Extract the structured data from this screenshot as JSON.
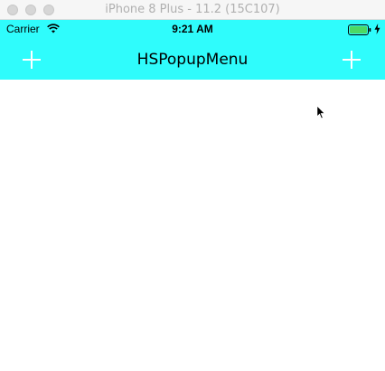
{
  "window": {
    "title": "iPhone 8 Plus - 11.2 (15C107)"
  },
  "status_bar": {
    "carrier": "Carrier",
    "time": "9:21 AM",
    "icons": [
      "wifi-icon",
      "battery-icon",
      "charging-bolt-icon"
    ]
  },
  "nav_bar": {
    "title": "HSPopupMenu",
    "left_button_icon": "plus-icon",
    "right_button_icon": "plus-icon"
  },
  "colors": {
    "nav_background": "#2ffcfc",
    "nav_button_tint": "#ffffff",
    "content_background": "#ffffff",
    "battery_fill": "#4cd964"
  }
}
